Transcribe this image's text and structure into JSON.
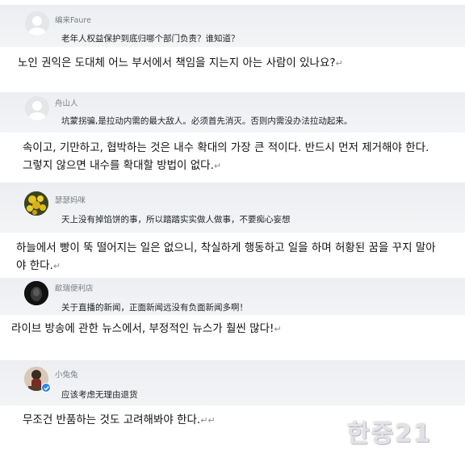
{
  "comments": [
    {
      "username": "编来Faure",
      "text": "老年人权益保护到底归哪个部门负责？谁知道？",
      "translation": "노인 권익은 도대체 어느 부서에서 책임을 지는지 아는 사람이 있나요?",
      "avatar": "default-avatar"
    },
    {
      "username": "舟山人",
      "text": "坑蒙拐骗,是拉动内需的最大敌人。必须首先消灭。否则内需没办法拉动起来。",
      "translation": "속이고, 기만하고, 협박하는 것은 내수 확대의 가장 큰 적이다. 반드시 먼저 제거해야 한다. 그렇지 않으면 내수를 확대할 방법이 없다.",
      "avatar": "yellow-flowers-avatar"
    },
    {
      "username": "瑟瑟妈咪",
      "text": "天上没有掉馅饼的事，所以踏踏实实做人做事，不要痴心妄想",
      "translation": "하늘에서 빵이 뚝 떨어지는 일은 없으니, 착실하게 행동하고 일을 하며 허황된 꿈을 꾸지 말아야 한다.",
      "avatar": "yellow-flowers-avatar"
    },
    {
      "username": "歃瑞便利店",
      "text": "关于直播的新闻，正面新闻远没有负面新闻多啊！",
      "translation": "라이브 방송에 관한 뉴스에서, 부정적인 뉴스가 훨씬 많다!",
      "avatar": "dark-avatar"
    },
    {
      "username": "小兔兔",
      "text": "应该考虑无理由退货",
      "translation": "무조건 반품하는 것도 고려해봐야 한다.",
      "avatar": "photo-avatar"
    }
  ],
  "paragraph_mark": "↵",
  "watermark": "한중21"
}
